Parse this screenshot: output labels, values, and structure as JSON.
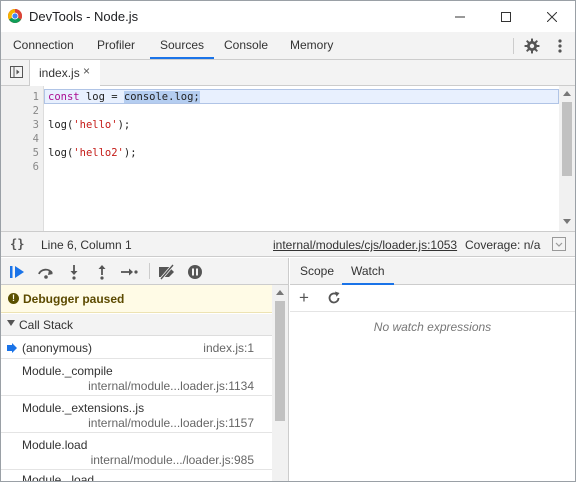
{
  "window": {
    "title": "DevTools - Node.js"
  },
  "main_tabs": [
    {
      "label": "Connection"
    },
    {
      "label": "Profiler"
    },
    {
      "label": "Sources"
    },
    {
      "label": "Console"
    },
    {
      "label": "Memory"
    }
  ],
  "active_main_tab": "Sources",
  "file_tab": {
    "name": "index.js",
    "close": "×"
  },
  "editor": {
    "line_numbers": [
      "1",
      "2",
      "3",
      "4",
      "5",
      "6"
    ],
    "lines": [
      {
        "kw": "const",
        "rest": " log = ",
        "sel": "console.log;"
      },
      {
        "text": ""
      },
      {
        "pre": "log(",
        "str": "'hello'",
        "post": ");"
      },
      {
        "text": ""
      },
      {
        "pre": "log(",
        "str": "'hello2'",
        "post": ");"
      },
      {
        "text": ""
      }
    ]
  },
  "status": {
    "braces": "{}",
    "position": "Line 6, Column 1",
    "location_link": "internal/modules/cjs/loader.js:1053",
    "coverage": "Coverage: n/a"
  },
  "debugger": {
    "paused_icon": "!",
    "paused_text": "Debugger paused",
    "call_stack_title": "Call Stack",
    "frames": [
      {
        "name": "(anonymous)",
        "location": "index.js:1"
      },
      {
        "name": "Module._compile",
        "location": "internal/module...loader.js:1134"
      },
      {
        "name": "Module._extensions..js",
        "location": "internal/module...loader.js:1157"
      },
      {
        "name": "Module.load",
        "location": "internal/module.../loader.js:985"
      },
      {
        "name": "Module._load",
        "location": ""
      }
    ]
  },
  "right_panel": {
    "tabs": [
      {
        "label": "Scope"
      },
      {
        "label": "Watch"
      }
    ],
    "active_tab": "Watch",
    "add_symbol": "+",
    "empty_text": "No watch expressions"
  },
  "colors": {
    "accent": "#1a73e8",
    "paused_bg": "#fffbe6",
    "keyword": "#aa0d91",
    "string": "#c41a16",
    "selection": "#b4cdf0"
  },
  "icons": [
    "chrome-logo-icon",
    "minimize-icon",
    "maximize-icon",
    "close-icon",
    "gear-icon",
    "more-vert-icon",
    "toggle-navigator-icon",
    "resume-icon",
    "step-over-icon",
    "step-into-icon",
    "step-out-icon",
    "step-icon",
    "deactivate-breakpoints-icon",
    "pause-on-exceptions-icon",
    "current-frame-arrow-icon",
    "add-icon",
    "refresh-icon",
    "coverage-icon"
  ]
}
